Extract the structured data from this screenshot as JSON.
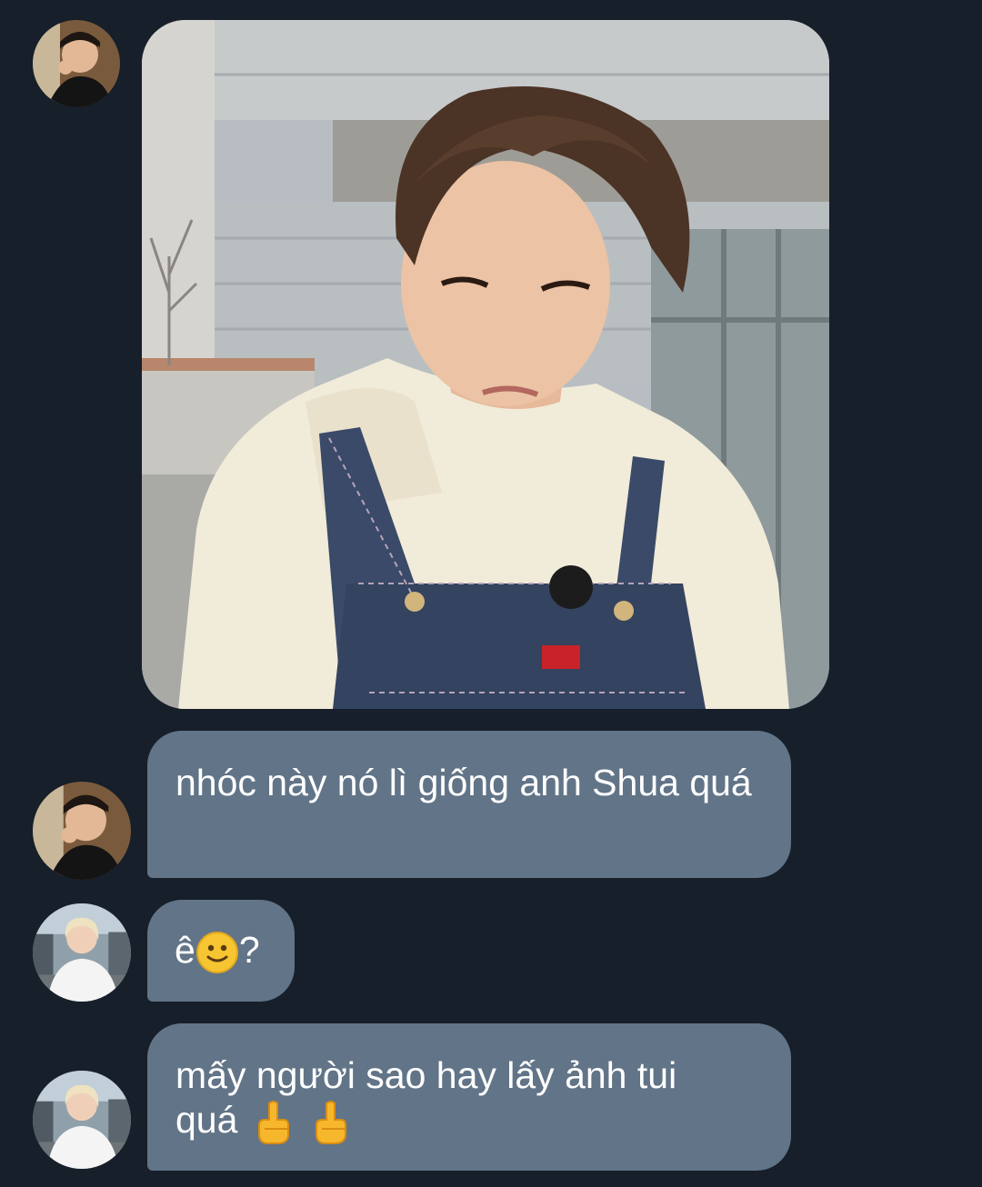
{
  "conversation": {
    "messages": [
      {
        "type": "image",
        "sender_avatar": "avatar-dark-hair",
        "image_description_icon": "photo-young-man-hoodie-overalls"
      },
      {
        "type": "text",
        "sender_avatar": "avatar-dark-hair",
        "text": "nhóc này nó lì giống anh Shua quá"
      },
      {
        "type": "text",
        "sender_avatar": "avatar-blond-hair",
        "text": "ê",
        "suffix": "?",
        "emoji": "slightly-smiling-face-icon"
      },
      {
        "type": "text",
        "sender_avatar": "avatar-blond-hair",
        "text_line1": "mấy người sao hay lấy ảnh tui",
        "text_line2": "quá",
        "emoji": "middle-finger-icon"
      }
    ]
  },
  "colors": {
    "background": "#161f2a",
    "bubble": "#627487",
    "text": "#ffffff"
  }
}
